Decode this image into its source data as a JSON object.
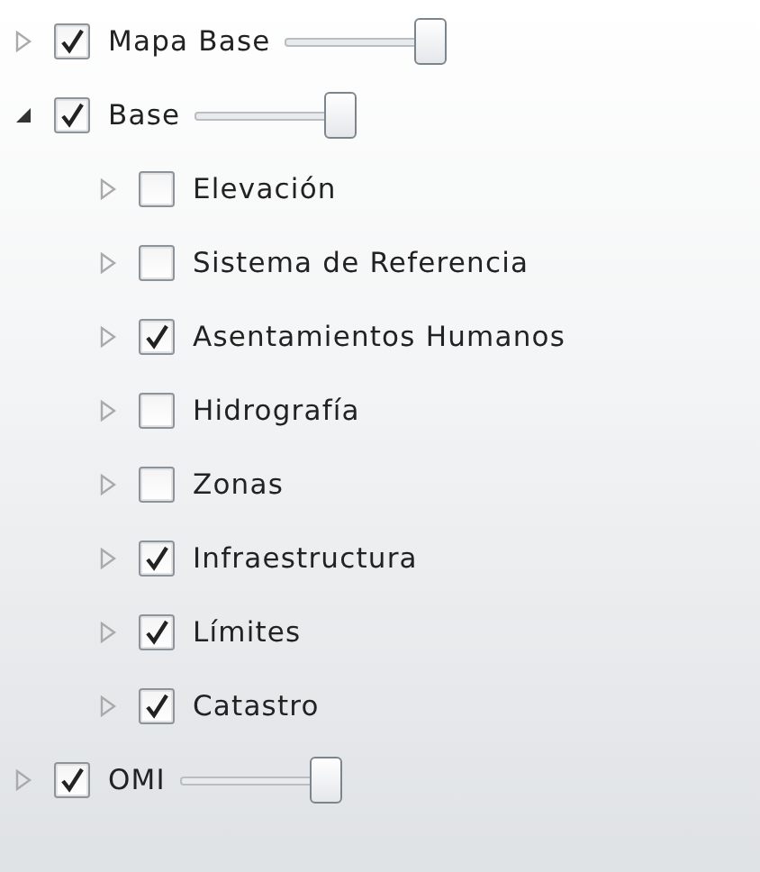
{
  "layers": [
    {
      "label": "Mapa Base",
      "checked": true,
      "expanded": false,
      "level": 1
    },
    {
      "label": "Base",
      "checked": true,
      "expanded": true,
      "level": 1,
      "children": [
        {
          "label": "Elevación",
          "checked": false,
          "expanded": false
        },
        {
          "label": "Sistema de Referencia",
          "checked": false,
          "expanded": false
        },
        {
          "label": "Asentamientos Humanos",
          "checked": true,
          "expanded": false
        },
        {
          "label": "Hidrografía",
          "checked": false,
          "expanded": false
        },
        {
          "label": "Zonas",
          "checked": false,
          "expanded": false
        },
        {
          "label": "Infraestructura",
          "checked": true,
          "expanded": false
        },
        {
          "label": "Límites",
          "checked": true,
          "expanded": false
        },
        {
          "label": "Catastro",
          "checked": true,
          "expanded": false
        }
      ]
    },
    {
      "label": "OMI",
      "checked": true,
      "expanded": false,
      "level": 1
    }
  ]
}
